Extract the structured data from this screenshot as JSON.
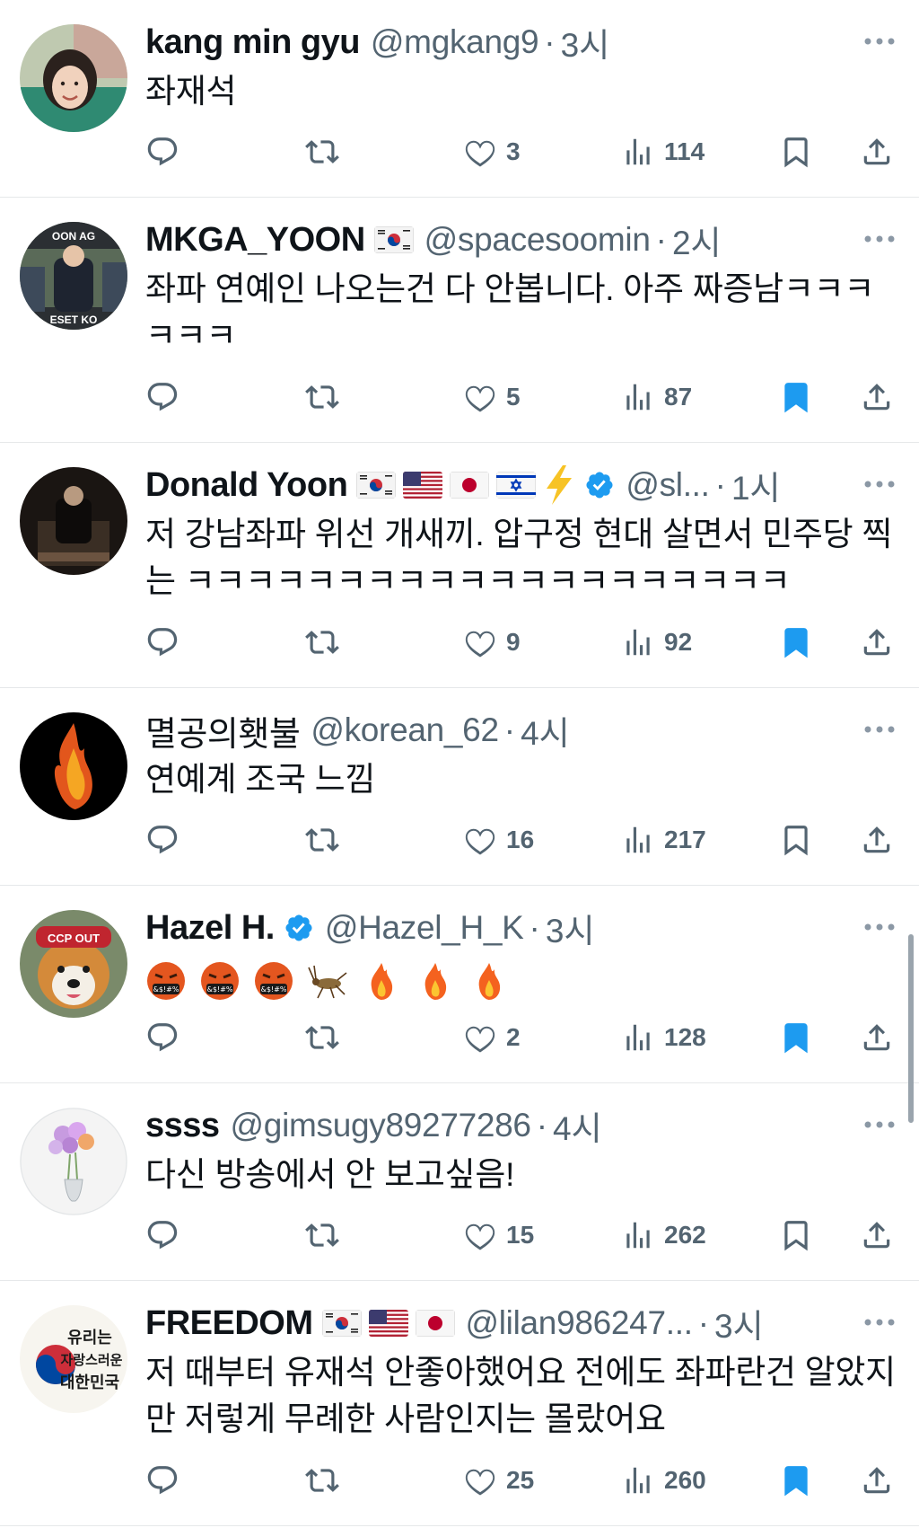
{
  "colors": {
    "accent": "#1d9bf0",
    "muted": "#536471",
    "text": "#0f1419",
    "divider": "#e6e8ea"
  },
  "tweets": [
    {
      "name": "kang min gyu",
      "flags": [],
      "verified": false,
      "handle": "@mgkang9",
      "time": "3시",
      "text": "좌재석",
      "likes": "3",
      "views": "114",
      "bookmarked": false
    },
    {
      "name": "MKGA_YOON",
      "flags": [
        "kr-flag"
      ],
      "verified": false,
      "handle": "@spacesoomin",
      "time": "2시",
      "text": "좌파 연예인 나오는건 다 안봅니다. 아주 짜증남ㅋㅋㅋㅋㅋㅋ",
      "likes": "5",
      "views": "87",
      "bookmarked": true
    },
    {
      "name": "Donald Yoon",
      "flags": [
        "kr-flag",
        "us-flag",
        "jp-flag",
        "il-flag",
        "lightning-icon"
      ],
      "verified": true,
      "handle": "@sl...",
      "time": "1시",
      "text": "저 강남좌파 위선 개새끼. 압구정 현대 살면서 민주당 찍는 ㅋㅋㅋㅋㅋㅋㅋㅋㅋㅋㅋㅋㅋㅋㅋㅋㅋㅋㅋㅋ",
      "likes": "9",
      "views": "92",
      "bookmarked": true
    },
    {
      "name": "멸공의횃불",
      "flags": [],
      "verified": false,
      "handle": "@korean_62",
      "time": "4시",
      "text": "연예계 조국 느낌",
      "likes": "16",
      "views": "217",
      "bookmarked": false
    },
    {
      "name": "Hazel H.",
      "flags": [],
      "verified": true,
      "handle": "@Hazel_H_K",
      "time": "3시",
      "text": "",
      "emojis": [
        "cursing-face-icon",
        "cursing-face-icon",
        "cursing-face-icon",
        "cricket-icon",
        "fire-icon",
        "fire-icon",
        "fire-icon"
      ],
      "likes": "2",
      "views": "128",
      "bookmarked": true
    },
    {
      "name": "ssss",
      "flags": [],
      "verified": false,
      "handle": "@gimsugy89277286",
      "time": "4시",
      "text": "다신 방송에서 안 보고싶음!",
      "likes": "15",
      "views": "262",
      "bookmarked": false
    },
    {
      "name": "FREEDOM",
      "flags": [
        "kr-flag",
        "us-flag",
        "jp-flag"
      ],
      "verified": false,
      "handle": "@lilan986247...",
      "time": "3시",
      "text": "저 때부터 유재석 안좋아했어요 전에도 좌파란건 알았지만 저렇게 무례한 사람인지는 몰랐어요",
      "likes": "25",
      "views": "260",
      "bookmarked": true
    }
  ]
}
